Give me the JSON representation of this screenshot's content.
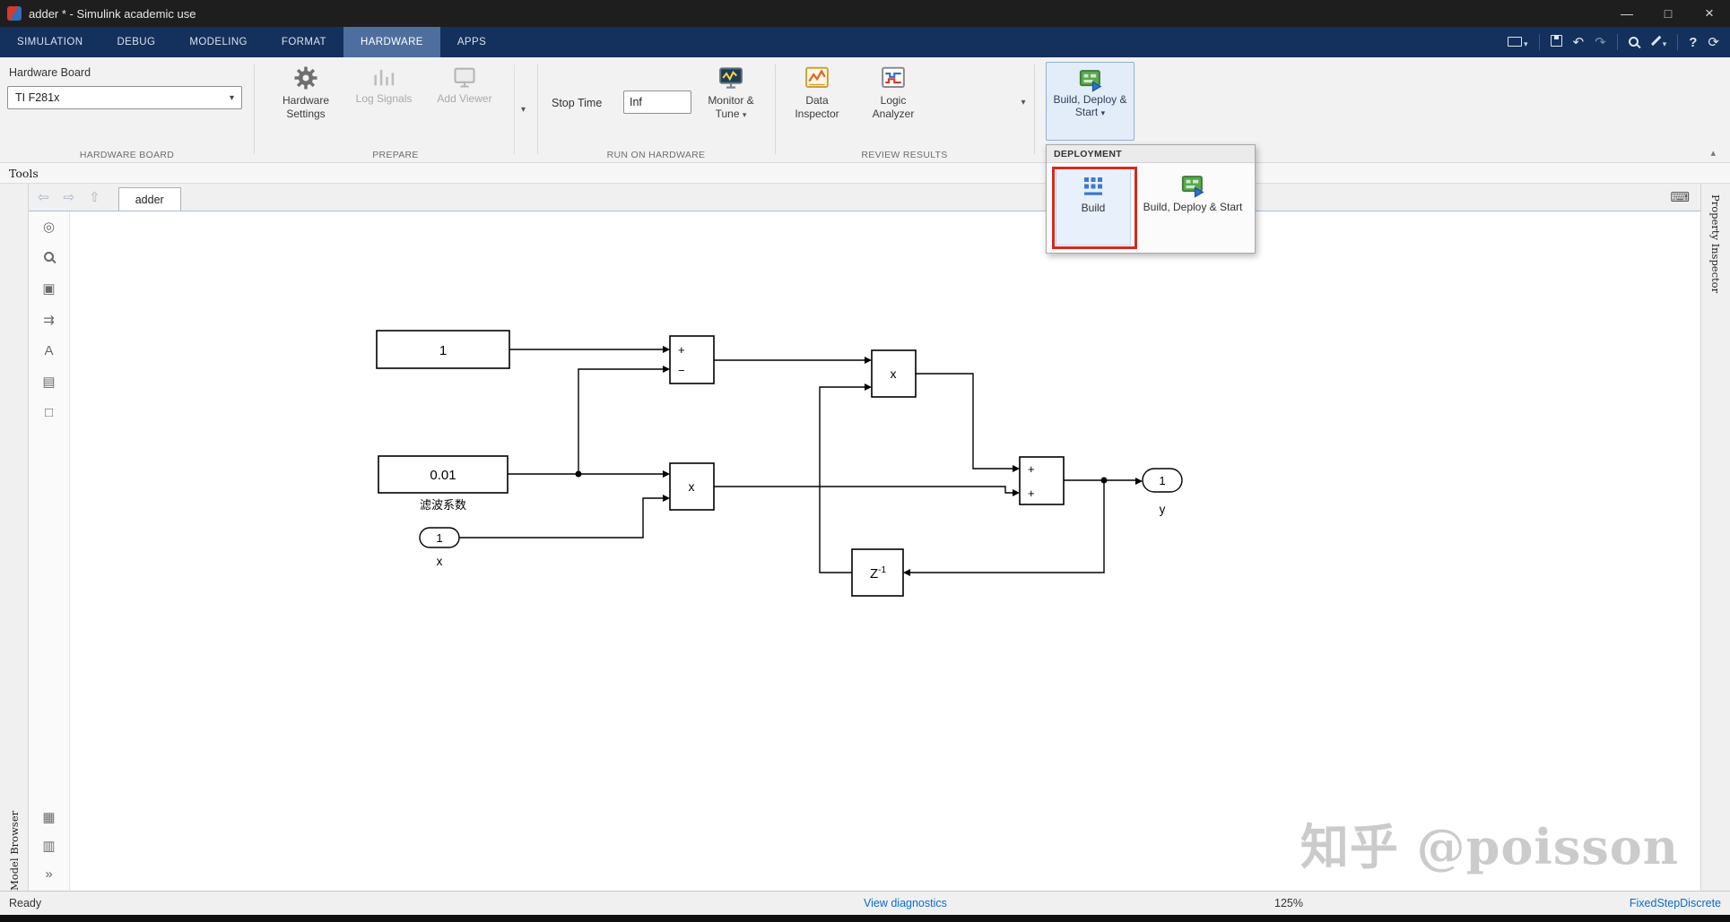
{
  "window": {
    "title": "adder * - Simulink academic use"
  },
  "tabstrip": {
    "tabs": [
      "SIMULATION",
      "DEBUG",
      "MODELING",
      "FORMAT",
      "HARDWARE",
      "APPS"
    ],
    "active": "HARDWARE"
  },
  "ribbon": {
    "hardware_board": {
      "title": "Hardware Board",
      "value": "TI F281x",
      "section": "HARDWARE BOARD"
    },
    "prepare": {
      "settings": "Hardware Settings",
      "log": "Log Signals",
      "viewer": "Add Viewer",
      "section": "PREPARE"
    },
    "run": {
      "stop_time_label": "Stop Time",
      "stop_time_value": "Inf",
      "monitor": "Monitor & Tune",
      "section": "RUN ON HARDWARE"
    },
    "review": {
      "data_inspector": "Data Inspector",
      "logic_analyzer": "Logic Analyzer",
      "section": "REVIEW RESULTS"
    },
    "deploy": {
      "button": "Build, Deploy & Start"
    }
  },
  "menu": {
    "header": "DEPLOYMENT",
    "build": "Build",
    "build_deploy": "Build, Deploy & Start"
  },
  "tools_row": {
    "label": "Tools"
  },
  "doctabs": {
    "active": "adder"
  },
  "side": {
    "left": "Model Browser",
    "right": "Property Inspector"
  },
  "status": {
    "ready": "Ready",
    "diagnostics": "View diagnostics",
    "zoom": "125%",
    "solver": "FixedStepDiscrete"
  },
  "watermark": {
    "text": "知乎 @poisson"
  },
  "diagram": {
    "const1": {
      "label": "1"
    },
    "const2": {
      "label": "0.01",
      "caption": "滤波系数"
    },
    "inport": {
      "label": "1",
      "caption": "x"
    },
    "sum1": {
      "signs": [
        "+",
        "−"
      ]
    },
    "prod1": {
      "label": "x"
    },
    "prod2": {
      "label": "x"
    },
    "sum2": {
      "signs": [
        "+",
        "+"
      ]
    },
    "delay": {
      "base": "Z",
      "exp": "-1"
    },
    "outport": {
      "label": "1",
      "caption": "y"
    }
  },
  "icons": {
    "minimize": "—",
    "maximize": "□",
    "close": "×",
    "caret": "▾",
    "back": "⇦",
    "forward": "⇨",
    "up": "⇧",
    "keyboard": "⌨",
    "collapse": "▴",
    "undo": "↶",
    "redo": "↷",
    "help": "?",
    "restore": "⟳",
    "chevrons": "»",
    "explorer": "◎",
    "fit": "▣",
    "route": "⇉",
    "annotate": "A",
    "image": "▤",
    "blank": "□",
    "camera": "▦",
    "snapshot": "▥"
  }
}
